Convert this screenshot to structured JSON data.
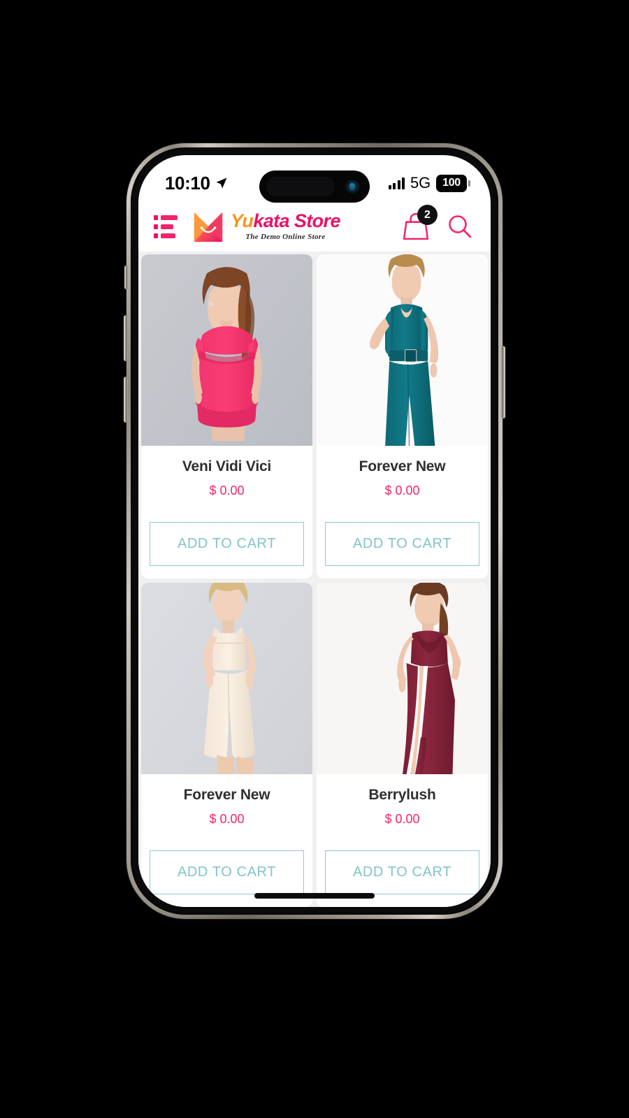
{
  "status_bar": {
    "time": "10:10",
    "location_icon": "location-arrow-icon",
    "signal_icon": "cellular-signal-icon",
    "network": "5G",
    "battery_level": "100"
  },
  "header": {
    "menu_icon": "hamburger-list-icon",
    "brand_mark_icon": "shopping-bag-logo-icon",
    "brand_name_part1": "Yu",
    "brand_name_part2": "kata Store",
    "brand_tagline": "The Demo Online Store",
    "cart_icon": "shopping-bag-icon",
    "cart_count": "2",
    "search_icon": "search-icon"
  },
  "products": [
    {
      "name": "Veni Vidi Vici",
      "price": "$ 0.00",
      "button_label": "ADD TO CART",
      "image_alt": "pink-off-shoulder-bodycon-dress"
    },
    {
      "name": "Forever New",
      "price": "$ 0.00",
      "button_label": "ADD TO CART",
      "image_alt": "teal-belted-wide-leg-jumpsuit"
    },
    {
      "name": "Forever New",
      "price": "$ 0.00",
      "button_label": "ADD TO CART",
      "image_alt": "cream-culotte-jumpsuit"
    },
    {
      "name": "Berrylush",
      "price": "$ 0.00",
      "button_label": "ADD TO CART",
      "image_alt": "maroon-maxi-dress-side-slit"
    }
  ],
  "colors": {
    "brand_pink": "#ec1164",
    "brand_orange": "#f7941e",
    "price_pink": "#f4246d",
    "button_teal": "#82c3cb",
    "badge_black": "#111114",
    "page_background": "#f0f0f0"
  }
}
